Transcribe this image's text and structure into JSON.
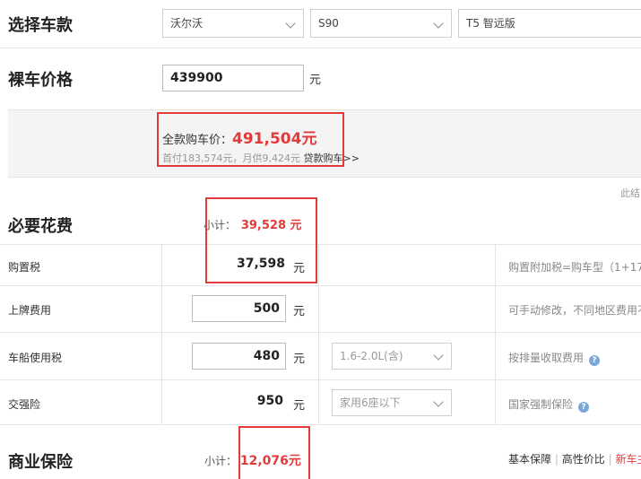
{
  "car_select": {
    "title": "选择车款",
    "brand": "沃尔沃",
    "model": "S90",
    "trim": "T5 智远版"
  },
  "bare_price": {
    "title": "裸车价格",
    "value": "439900",
    "unit": "元"
  },
  "full_price": {
    "label": "全款购车价：",
    "amount": "491,504元",
    "detail": "首付183,574元，月供9,424元",
    "loan_link": "贷款购车>>",
    "side_note": "此结"
  },
  "required": {
    "title": "必要花费",
    "subtotal_label": "小计：",
    "subtotal_value": "39,528 元",
    "rows": [
      {
        "label": "购置税",
        "value": "37,598",
        "unit": "元",
        "note": "购置附加税=购车型（1+17"
      },
      {
        "label": "上牌费用",
        "value": "500",
        "unit": "元",
        "note": "可手动修改，不同地区费用不"
      },
      {
        "label": "车船使用税",
        "value": "480",
        "unit": "元",
        "option": "1.6-2.0L(含)",
        "note": "按排量收取费用"
      },
      {
        "label": "交强险",
        "value": "950",
        "unit": "元",
        "option": "家用6座以下",
        "note": "国家强制保险"
      }
    ]
  },
  "commercial": {
    "title": "商业保险",
    "subtotal_label": "小计：",
    "subtotal_value": "12,076元",
    "plans": [
      "基本保障",
      "高性价比",
      "新车主"
    ]
  },
  "icons": {
    "help": "?"
  },
  "colors": {
    "accent_red": "#e23b3b",
    "help_blue": "#7aa7d8"
  }
}
